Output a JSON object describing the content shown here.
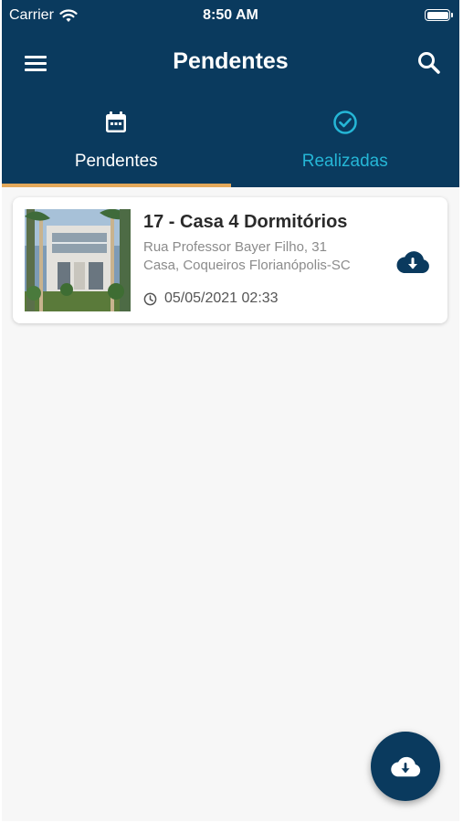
{
  "status_bar": {
    "carrier": "Carrier",
    "time": "8:50 AM"
  },
  "app_bar": {
    "title": "Pendentes",
    "menu_icon": "menu-icon",
    "search_icon": "search-icon"
  },
  "tabs": [
    {
      "label": "Pendentes",
      "icon": "calendar-icon",
      "active": true
    },
    {
      "label": "Realizadas",
      "icon": "check-circle-icon",
      "active": false
    }
  ],
  "items": [
    {
      "title": "17 - Casa 4 Dormitórios",
      "address_line1": "Rua Professor Bayer Filho, 31",
      "address_line2": "Casa, Coqueiros Florianópolis-SC",
      "datetime": "05/05/2021 02:33",
      "action_icon": "cloud-download-icon"
    }
  ],
  "fab": {
    "icon": "cloud-download-icon"
  },
  "colors": {
    "primary": "#0a3a5e",
    "tab_inactive": "#25b6d6",
    "tab_indicator": "#e3a85a",
    "background": "#f7f7f7"
  }
}
